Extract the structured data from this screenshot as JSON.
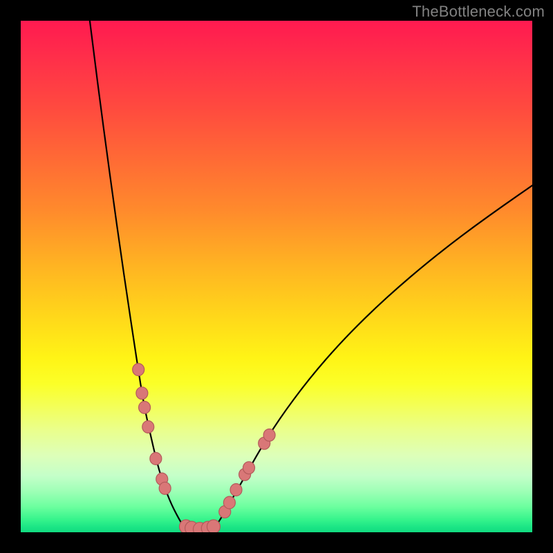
{
  "header": {
    "watermark": "TheBottleneck.com"
  },
  "colors": {
    "frame": "#000000",
    "curve": "#000000",
    "marker_fill": "#d97777",
    "marker_stroke": "#b35a5a",
    "gradient_top": "#ff1a50",
    "gradient_mid": "#ffd81a",
    "gradient_bottom": "#11db80"
  },
  "chart_data": {
    "type": "line",
    "title": "",
    "xlabel": "",
    "ylabel": "",
    "xlim": [
      0,
      100
    ],
    "ylim": [
      0,
      100
    ],
    "grid": false,
    "legend": false,
    "curve_left": {
      "x": [
        13.5,
        14.5,
        15.6,
        16.8,
        18.1,
        19.5,
        20.9,
        22.1,
        23.1,
        23.9,
        24.7,
        25.5,
        26.3,
        27.1,
        27.9,
        28.7,
        29.5,
        30.3,
        31.0,
        31.6,
        32.0
      ],
      "y": [
        100.0,
        92.0,
        83.5,
        74.5,
        65.0,
        55.0,
        45.5,
        37.5,
        31.0,
        26.0,
        22.0,
        18.5,
        15.0,
        12.0,
        9.5,
        7.3,
        5.4,
        3.8,
        2.5,
        1.5,
        1.0
      ]
    },
    "plateau": {
      "x": [
        32.0,
        33.0,
        34.0,
        35.0,
        36.0,
        37.0,
        38.0
      ],
      "y": [
        1.0,
        0.7,
        0.6,
        0.55,
        0.6,
        0.7,
        1.0
      ]
    },
    "curve_right": {
      "x": [
        38.0,
        39.0,
        40.2,
        41.6,
        43.2,
        45.0,
        47.0,
        49.3,
        51.9,
        54.8,
        58.0,
        61.5,
        65.3,
        69.4,
        73.8,
        78.5,
        83.5,
        88.8,
        94.4,
        100.0
      ],
      "y": [
        1.0,
        2.5,
        4.5,
        7.0,
        9.8,
        13.0,
        16.5,
        20.2,
        24.0,
        27.9,
        31.9,
        35.9,
        39.9,
        43.9,
        47.9,
        51.9,
        55.9,
        59.9,
        63.9,
        67.8
      ]
    },
    "markers_left_arm": [
      {
        "x": 23.0,
        "y": 31.8
      },
      {
        "x": 23.7,
        "y": 27.2
      },
      {
        "x": 24.2,
        "y": 24.4
      },
      {
        "x": 24.9,
        "y": 20.6
      },
      {
        "x": 26.4,
        "y": 14.4
      },
      {
        "x": 27.6,
        "y": 10.4
      },
      {
        "x": 28.2,
        "y": 8.6
      }
    ],
    "markers_bottom": [
      {
        "x": 32.3,
        "y": 1.1
      },
      {
        "x": 33.4,
        "y": 0.8
      },
      {
        "x": 35.0,
        "y": 0.6
      },
      {
        "x": 36.6,
        "y": 0.8
      },
      {
        "x": 37.7,
        "y": 1.1
      }
    ],
    "markers_right_arm": [
      {
        "x": 39.9,
        "y": 4.0
      },
      {
        "x": 40.8,
        "y": 5.8
      },
      {
        "x": 42.1,
        "y": 8.3
      },
      {
        "x": 43.8,
        "y": 11.3
      },
      {
        "x": 44.6,
        "y": 12.6
      },
      {
        "x": 47.6,
        "y": 17.4
      },
      {
        "x": 48.6,
        "y": 19.0
      }
    ]
  }
}
